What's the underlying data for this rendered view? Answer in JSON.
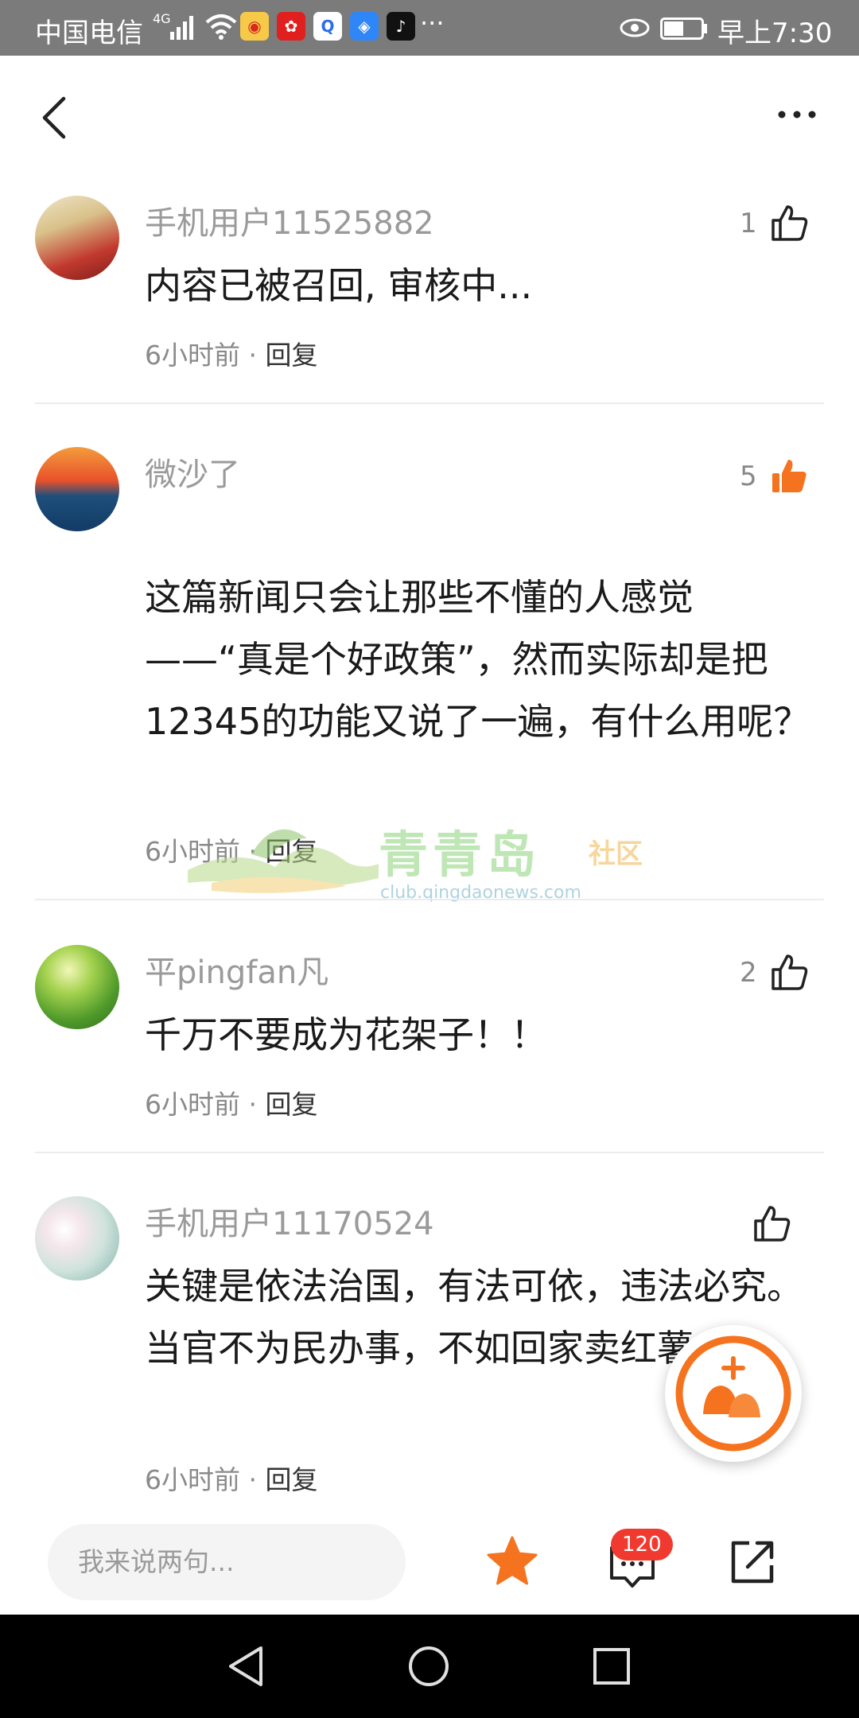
{
  "status_bar": {
    "carrier": "中国电信",
    "network": "4G",
    "more": "···",
    "time": "早上7:30",
    "app_icons": [
      "weibo-icon",
      "news-app-icon",
      "search-app-icon",
      "cloud-app-icon",
      "tiktok-icon"
    ]
  },
  "colors": {
    "accent": "#f5731f",
    "badge": "#f13a2f"
  },
  "comments": [
    {
      "user": "手机用户11525882",
      "text": "内容已被召回, 审核中...",
      "time": "6小时前",
      "sep": " · ",
      "reply": "回复",
      "likes": "1",
      "liked": false
    },
    {
      "user": "微沙了",
      "text": "这篇新闻只会让那些不懂的人感觉——“真是个好政策”，然而实际却是把12345的功能又说了一遍，有什么用呢？",
      "time": "6小时前",
      "sep": " · ",
      "reply": "回复",
      "likes": "5",
      "liked": true
    },
    {
      "user": "平pingfan凡",
      "text": "千万不要成为花架子！！",
      "time": "6小时前",
      "sep": " · ",
      "reply": "回复",
      "likes": "2",
      "liked": false
    },
    {
      "user": "手机用户11170524",
      "text": "关键是依法治国，有法可依，违法必究。当官不为民办事，不如回家卖红薯。",
      "time": "6小时前",
      "sep": " · ",
      "reply": "回复",
      "likes": "",
      "liked": false
    }
  ],
  "watermark": {
    "main": "青青岛",
    "sub": "社区",
    "url": "club.qingdaonews.com"
  },
  "bottom_bar": {
    "input_placeholder": "我来说两句...",
    "comment_count": "120"
  }
}
